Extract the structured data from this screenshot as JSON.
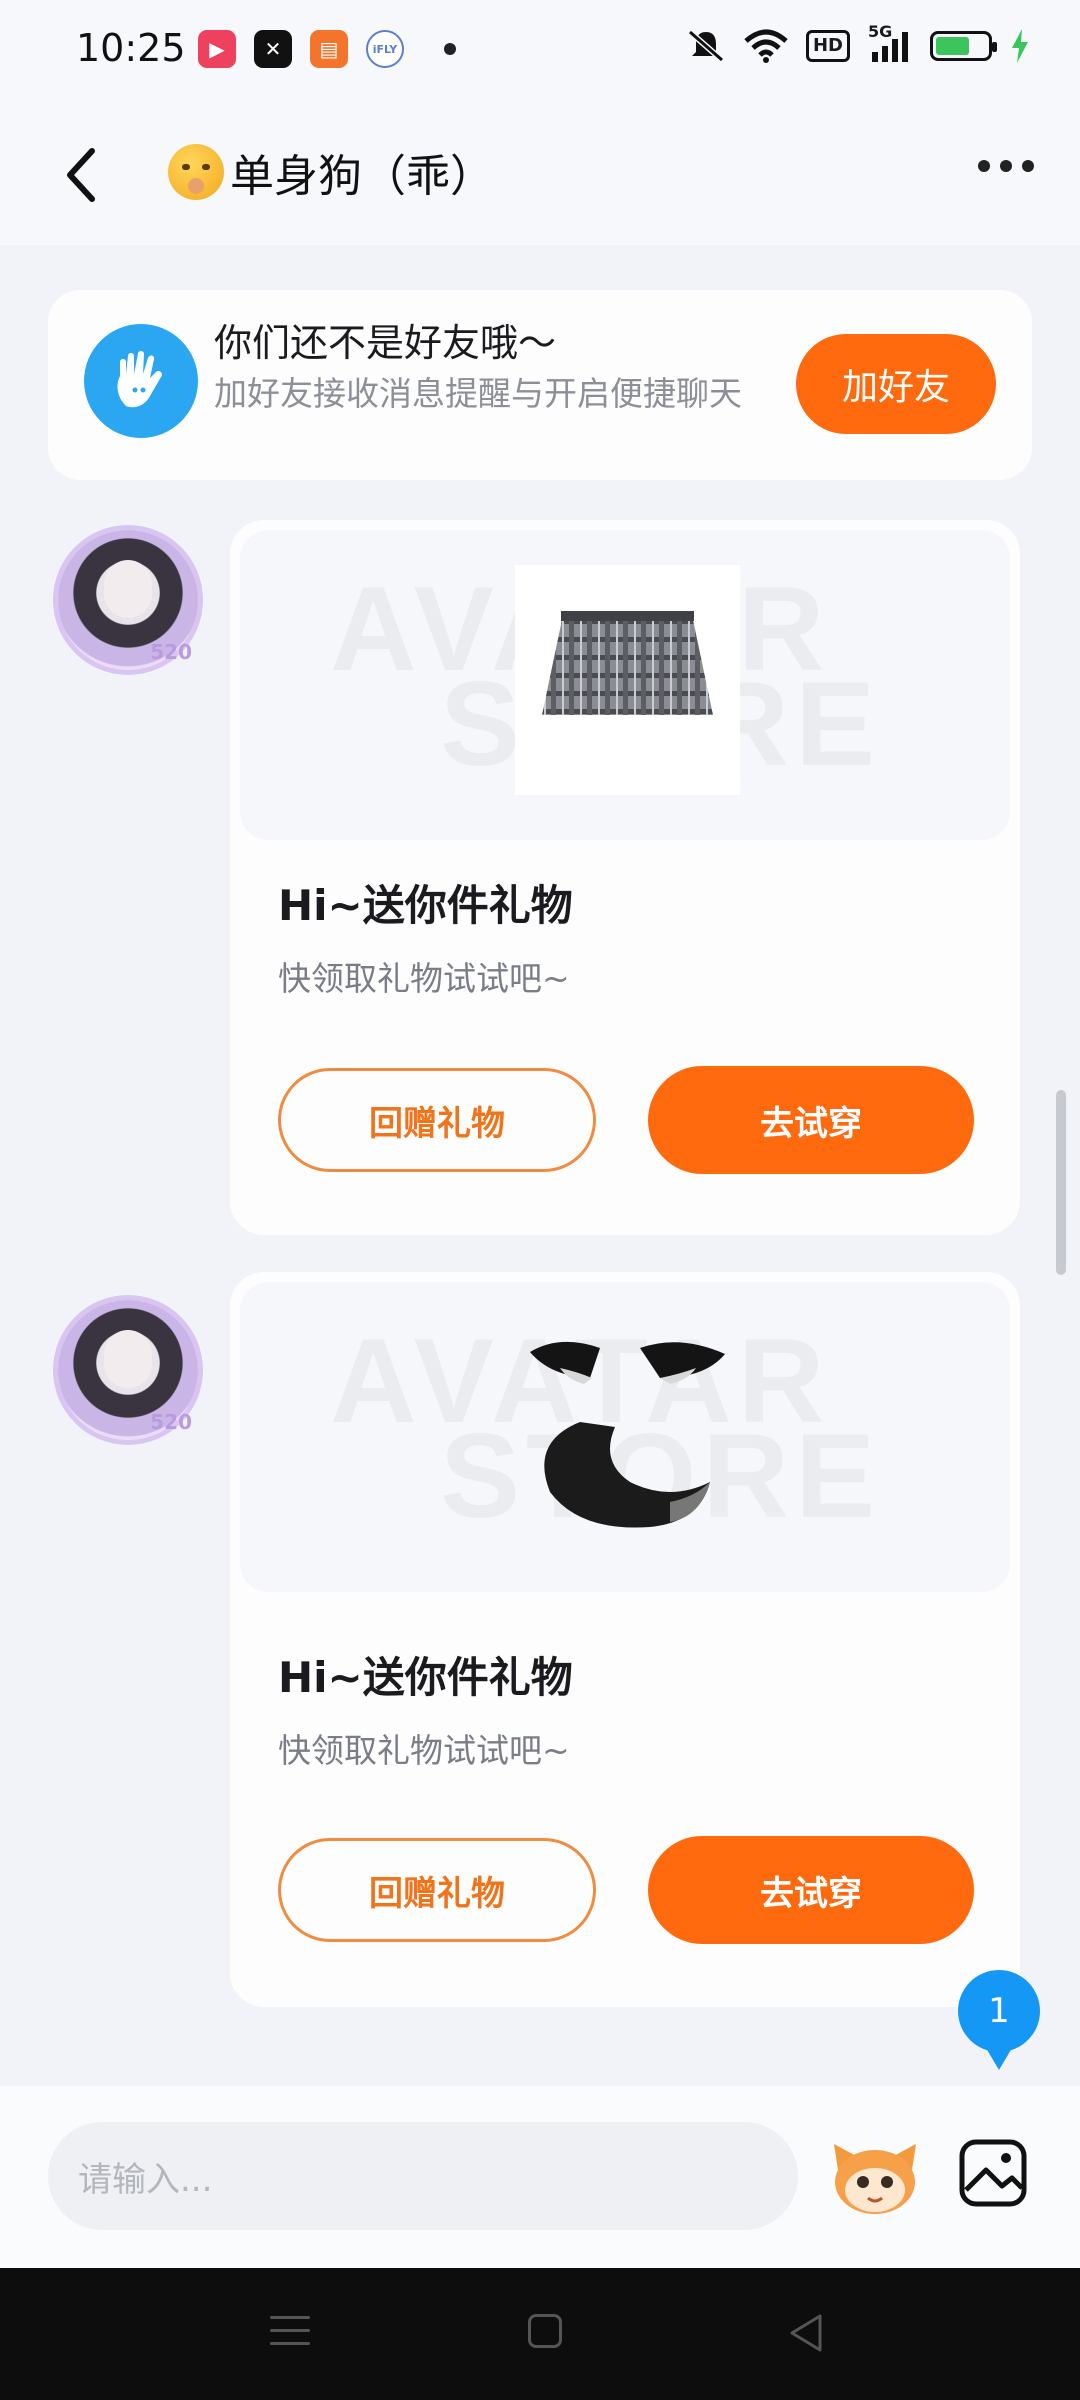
{
  "status_bar": {
    "time": "10:25",
    "hd_label": "HD",
    "network_label": "5G",
    "battery_level": 0.7,
    "apps": [
      {
        "icon": "video-app-icon",
        "color": "#ee4160"
      },
      {
        "icon": "capcut-app-icon",
        "color": "#111111"
      },
      {
        "icon": "reader-app-icon",
        "color": "#f2752b"
      },
      {
        "icon": "ifly-app-icon",
        "color": "#ffffff",
        "label": "iFLY"
      }
    ]
  },
  "header": {
    "title": "单身狗（乖）"
  },
  "friend_banner": {
    "title": "你们还不是好友哦～",
    "subtitle": "加好友接收消息提醒与开启便捷聊天",
    "add_button": "加好友"
  },
  "messages": [
    {
      "item": "plaid-skirt",
      "title": "Hi~送你件礼物",
      "subtitle": "快领取礼物试试吧~",
      "return_gift_button": "回赠礼物",
      "try_on_button": "去试穿"
    },
    {
      "item": "fox-ears-and-tail",
      "title": "Hi~送你件礼物",
      "subtitle": "快领取礼物试试吧~",
      "return_gift_button": "回赠礼物",
      "try_on_button": "去试穿"
    }
  ],
  "avatar_badge": "520",
  "watermark": [
    "AVATAR",
    "STORE"
  ],
  "unread_badge": "1",
  "input_bar": {
    "placeholder": "请输入..."
  },
  "colors": {
    "accent": "#ff6a0f",
    "badge": "#1598f5",
    "background": "#f1f3f8"
  }
}
